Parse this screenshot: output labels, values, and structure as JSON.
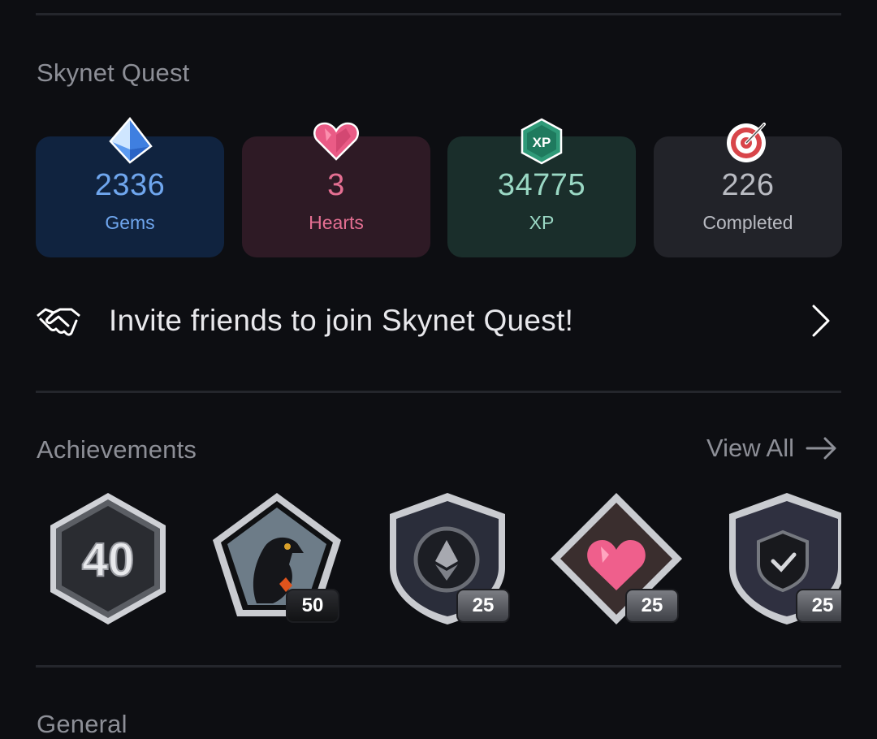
{
  "quest": {
    "title": "Skynet Quest",
    "stats": [
      {
        "value": "2336",
        "label": "Gems",
        "icon": "gem-icon",
        "color": "#6fa6ee",
        "bg": "#10233f"
      },
      {
        "value": "3",
        "label": "Hearts",
        "icon": "heart-icon",
        "color": "#e46f92",
        "bg": "#2e1a25"
      },
      {
        "value": "34775",
        "label": "XP",
        "icon": "xp-icon",
        "color": "#9ad8c4",
        "bg": "#1a2e2b"
      },
      {
        "value": "226",
        "label": "Completed",
        "icon": "target-icon",
        "color": "#b9bbc2",
        "bg": "#222329"
      }
    ]
  },
  "invite": {
    "text": "Invite friends to join Skynet Quest!",
    "icon": "handshake-icon"
  },
  "achievements": {
    "title": "Achievements",
    "view_all_label": "View All",
    "badges": [
      {
        "name": "badge-40",
        "badge_text": "40",
        "count": ""
      },
      {
        "name": "badge-falcon",
        "count": "50"
      },
      {
        "name": "badge-ethereum",
        "count": "25"
      },
      {
        "name": "badge-heart",
        "count": "25"
      },
      {
        "name": "badge-shield",
        "count": "25"
      }
    ]
  },
  "general": {
    "title": "General"
  }
}
